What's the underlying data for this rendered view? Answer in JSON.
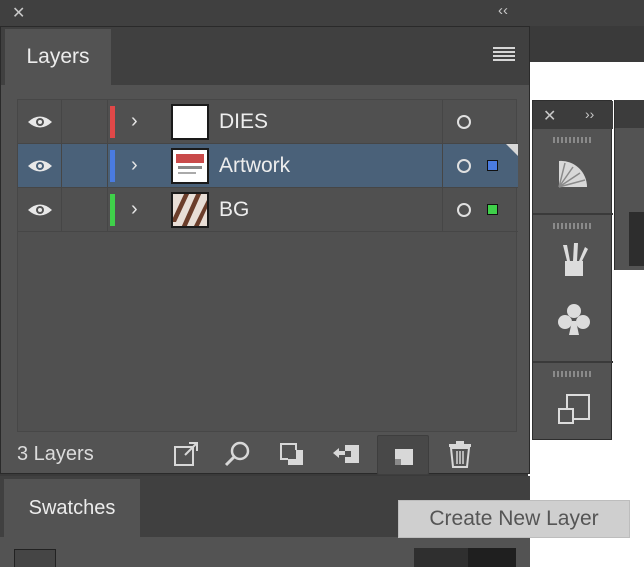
{
  "window": {
    "close_glyph": "✕",
    "collapse_glyph": "‹‹"
  },
  "layers_panel": {
    "tab_label": "Layers",
    "menu_icon": "hamburger-menu-icon",
    "layers": [
      {
        "name": "DIES",
        "color": "#e04848",
        "selected": false,
        "visible": true,
        "square_color": null
      },
      {
        "name": "Artwork",
        "color": "#4a7be0",
        "selected": true,
        "visible": true,
        "square_color": "#4a7be0"
      },
      {
        "name": "BG",
        "color": "#3fd04a",
        "selected": false,
        "visible": true,
        "square_color": "#3fd04a"
      }
    ],
    "footer": {
      "count_label": "3 Layers",
      "icons": [
        "export-icon",
        "locate-object-icon",
        "make-clipping-mask-icon",
        "new-sublayer-icon",
        "create-new-layer-icon",
        "delete-icon"
      ]
    }
  },
  "swatches_panel": {
    "tab_label": "Swatches"
  },
  "tooltip": {
    "text": "Create New Layer"
  },
  "side_panel": {
    "close_glyph": "✕",
    "expand_glyph": "››",
    "icons": [
      "gradient-fan-icon",
      "brushes-icon",
      "symbols-club-icon",
      "artboards-icon"
    ]
  },
  "colors": {
    "panel_bg": "#535353",
    "selected_row": "#4a6179",
    "dark_bg": "#404040"
  }
}
